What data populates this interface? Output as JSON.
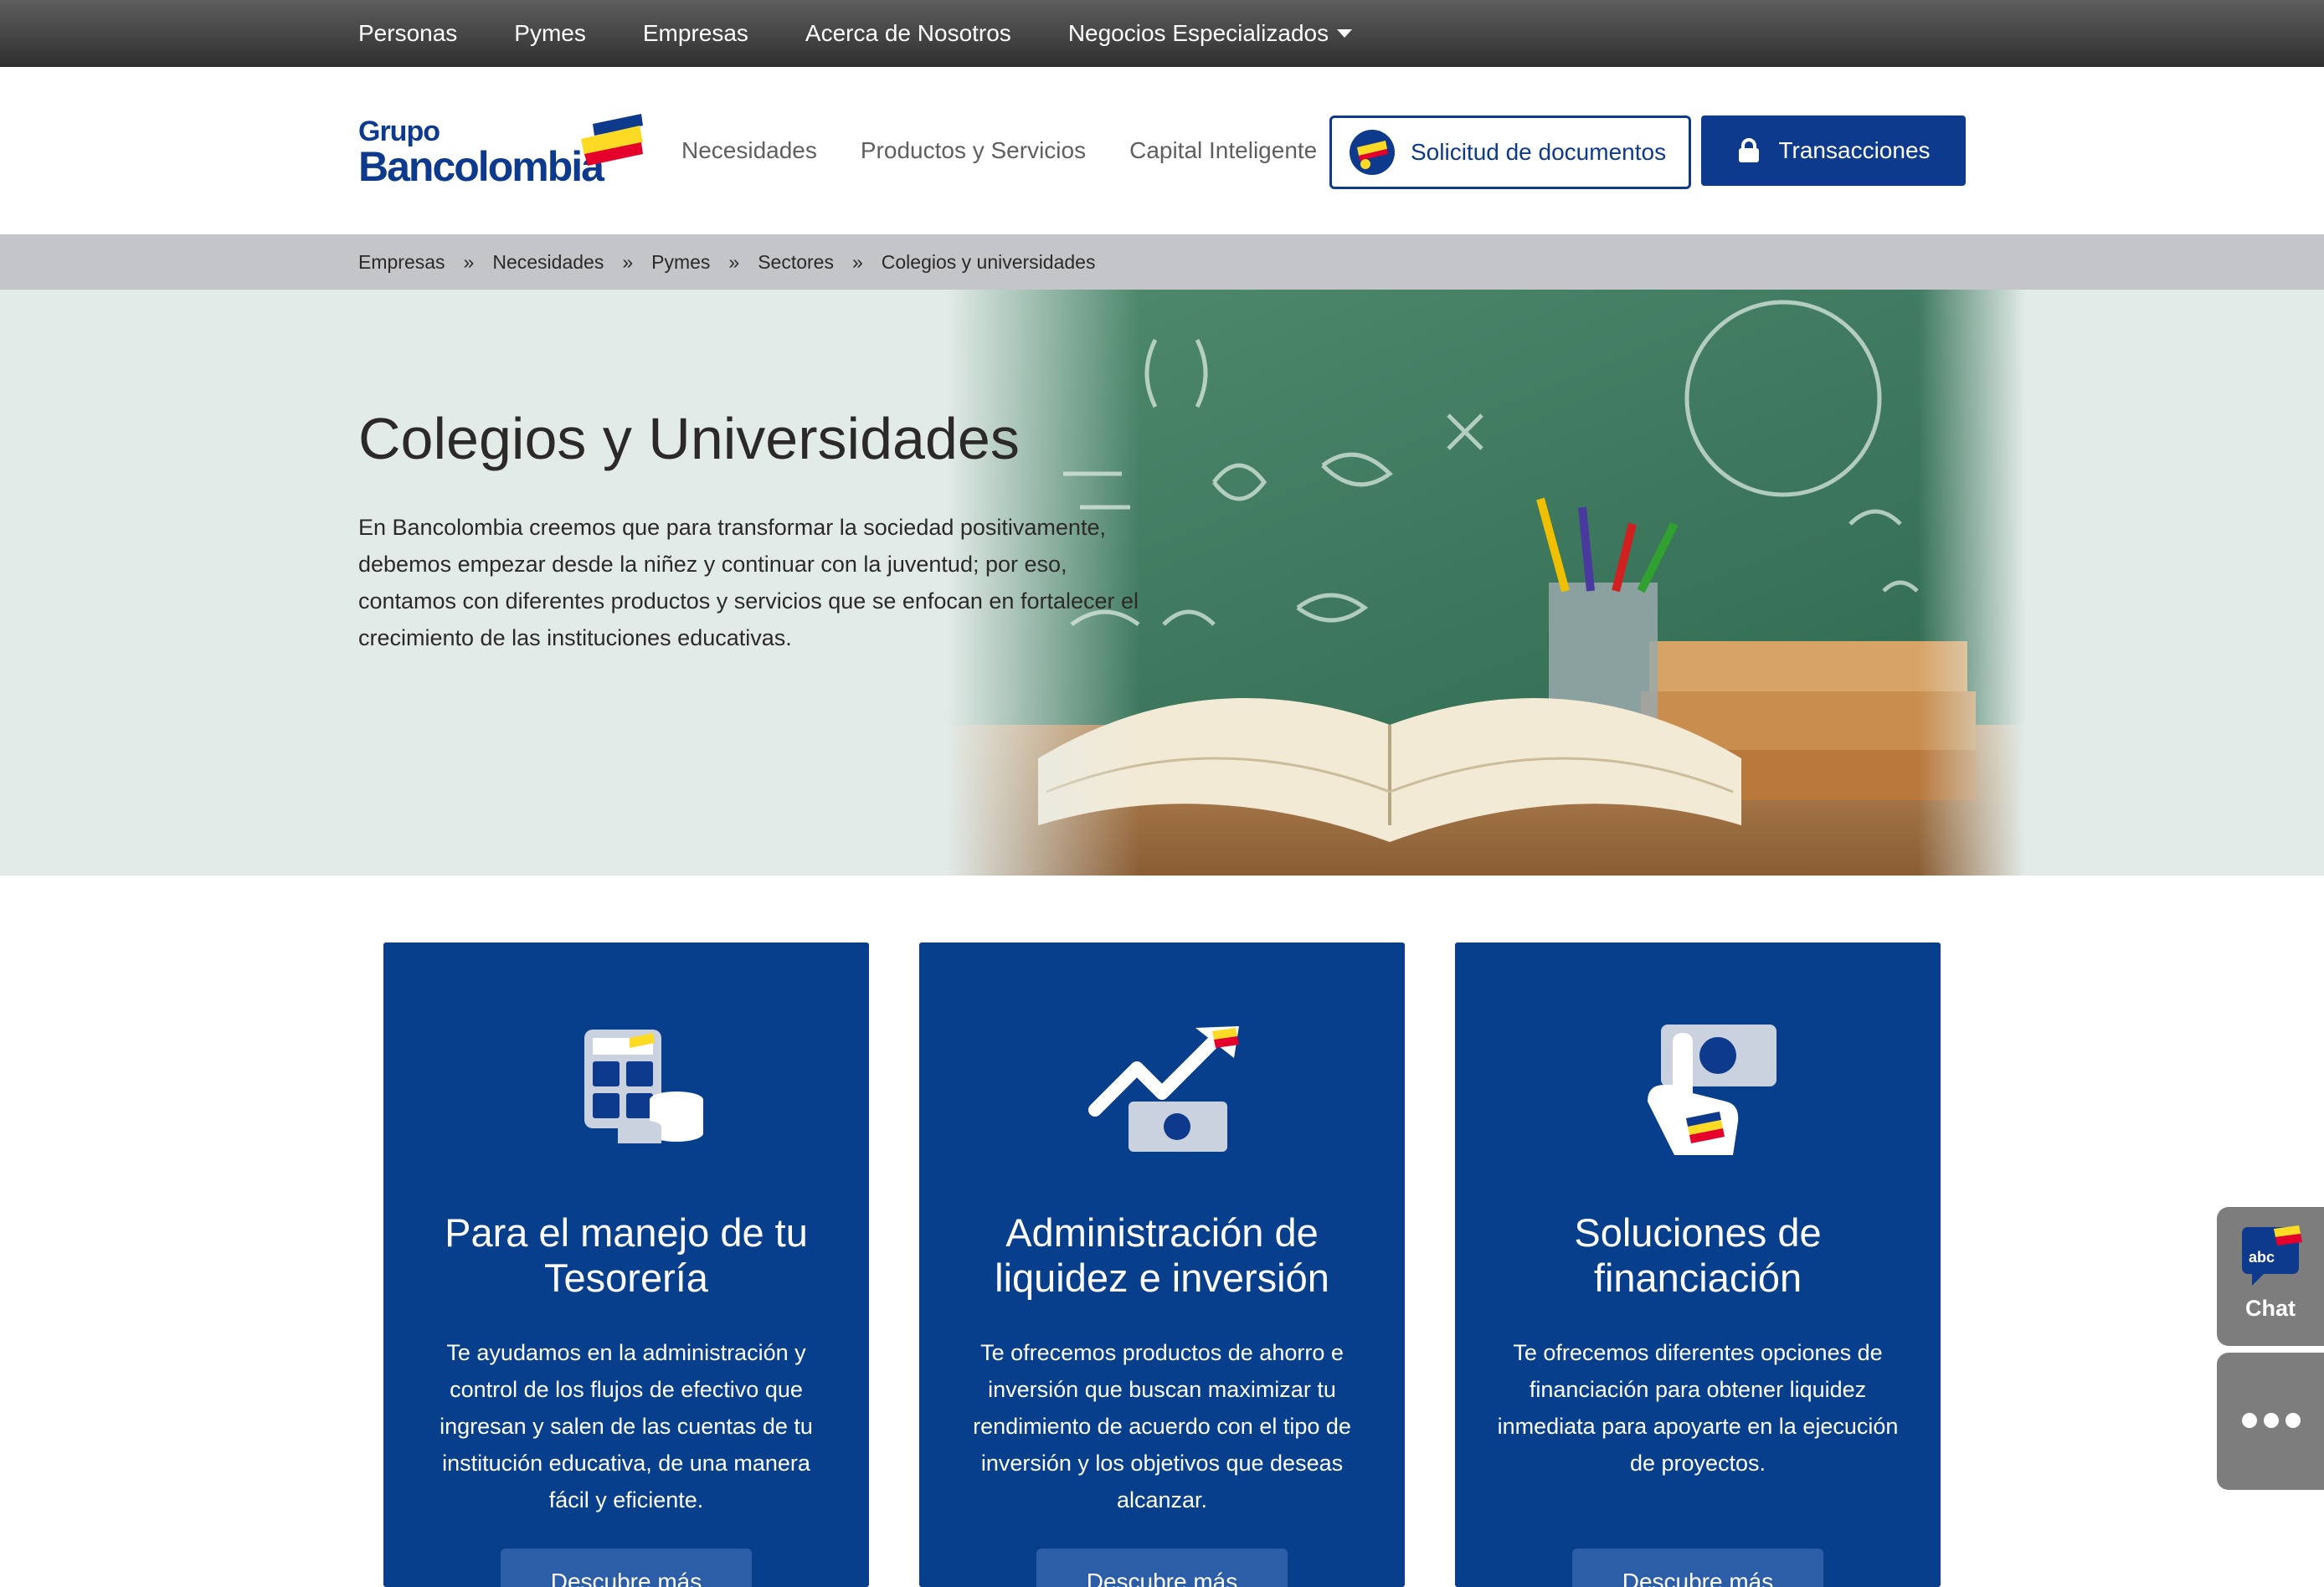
{
  "topnav": {
    "items": [
      "Personas",
      "Pymes",
      "Empresas",
      "Acerca de Nosotros",
      "Negocios Especializados"
    ]
  },
  "logo": {
    "line1": "Grupo",
    "line2": "Bancolombia"
  },
  "mainnav": {
    "items": [
      "Necesidades",
      "Productos y Servicios",
      "Capital Inteligente"
    ]
  },
  "header_buttons": {
    "docs_label": "Solicitud de documentos",
    "transactions_label": "Transacciones"
  },
  "breadcrumb": {
    "items": [
      "Empresas",
      "Necesidades",
      "Pymes",
      "Sectores",
      "Colegios y universidades"
    ],
    "separator": "»"
  },
  "hero": {
    "title": "Colegios y Universidades",
    "text": "En Bancolombia creemos que para transformar la sociedad positivamente, debemos empezar desde la niñez y continuar con la juventud; por eso, contamos con diferentes productos y servicios que se enfocan en fortalecer el crecimiento de las instituciones educativas."
  },
  "cards": [
    {
      "icon": "calculator-coins-icon",
      "title": "Para el manejo de tu Tesorería",
      "text": "Te ayudamos en la administración y control de los flujos de efectivo que ingresan y salen de las cuentas de tu institución educativa, de una manera fácil y eficiente.",
      "cta": "Descubre más"
    },
    {
      "icon": "growth-arrow-money-icon",
      "title": "Administración de liquidez e inversión",
      "text": "Te ofrecemos productos de ahorro e inversión que buscan maximizar tu rendimiento de acuerdo con el tipo de inversión y los objetivos que deseas alcanzar.",
      "cta": "Descubre más"
    },
    {
      "icon": "hand-bill-icon",
      "title": "Soluciones de financiación",
      "text": "Te ofrecemos diferentes opciones de financiación para obtener liquidez inmediata para apoyarte en la ejecución de proyectos.",
      "cta": "Descubre más"
    }
  ],
  "side_widgets": {
    "chat_label": "Chat",
    "chat_badge": "abc"
  },
  "colors": {
    "brand_blue": "#0d3a8c",
    "card_blue": "#073f8c",
    "flag_yellow": "#fdda24",
    "flag_red": "#e4002b",
    "hero_bg": "#e3ebe8"
  }
}
